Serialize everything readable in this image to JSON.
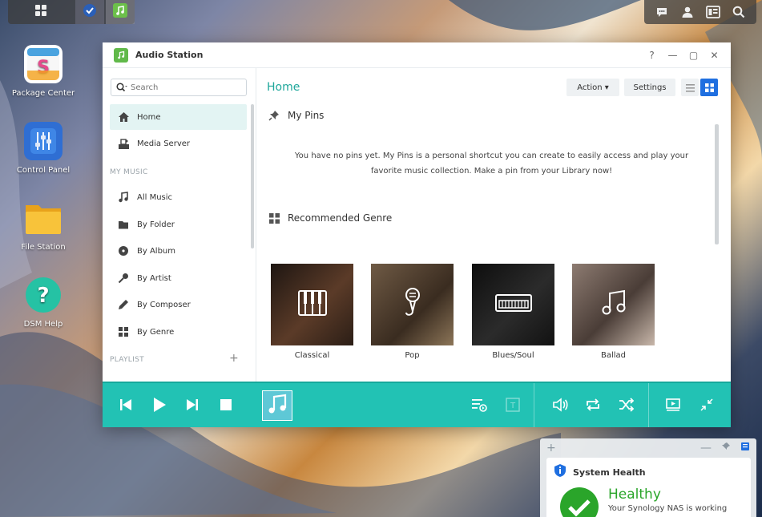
{
  "desktop": {
    "icons": [
      {
        "label": "Package Center",
        "icon": "package-center-icon"
      },
      {
        "label": "Control Panel",
        "icon": "control-panel-icon"
      },
      {
        "label": "File Station",
        "icon": "file-station-icon"
      },
      {
        "label": "DSM Help",
        "icon": "dsm-help-icon"
      }
    ]
  },
  "taskbar": {
    "left": [
      "main-menu-icon",
      "synology-sync-icon",
      "audio-station-icon"
    ],
    "right": [
      "chat-icon",
      "user-icon",
      "widgets-icon",
      "search-icon"
    ]
  },
  "window": {
    "title": "Audio Station",
    "controls": {
      "help": "?",
      "minimize": "—",
      "maximize": "▢",
      "close": "✕"
    }
  },
  "sidebar": {
    "search_placeholder": "Search",
    "items": [
      {
        "label": "Home",
        "icon": "home-icon",
        "active": true
      },
      {
        "label": "Media Server",
        "icon": "media-server-icon"
      }
    ],
    "my_music_heading": "MY MUSIC",
    "my_music": [
      {
        "label": "All Music",
        "icon": "music-note-icon"
      },
      {
        "label": "By Folder",
        "icon": "folder-icon"
      },
      {
        "label": "By Album",
        "icon": "album-icon"
      },
      {
        "label": "By Artist",
        "icon": "microphone-icon"
      },
      {
        "label": "By Composer",
        "icon": "pen-icon"
      },
      {
        "label": "By Genre",
        "icon": "grid-icon"
      }
    ],
    "playlist_heading": "PLAYLIST",
    "add_label": "+"
  },
  "main": {
    "title": "Home",
    "action_label": "Action ▾",
    "settings_label": "Settings",
    "pins_heading": "My Pins",
    "pins_message_line1": "You have no pins yet. My Pins is a personal shortcut you can create to easily access and play your",
    "pins_message_line2": "favorite music collection. Make a pin from your Library now!",
    "genre_heading": "Recommended Genre",
    "genres": [
      {
        "label": "Classical",
        "icon": "piano-icon",
        "color": "#3b2a22"
      },
      {
        "label": "Pop",
        "icon": "microphone-icon",
        "color": "#5a4635"
      },
      {
        "label": "Blues/Soul",
        "icon": "keyboard-icon",
        "color": "#1d1d1d"
      },
      {
        "label": "Ballad",
        "icon": "music-note-icon",
        "color": "#6b5a52"
      }
    ]
  },
  "player": {
    "accent": "#22c2b4",
    "buttons": [
      "previous-icon",
      "play-icon",
      "next-icon",
      "stop-icon",
      "queue-icon",
      "lyrics-icon",
      "volume-icon",
      "repeat-icon",
      "shuffle-icon",
      "cast-icon",
      "mini-player-icon"
    ]
  },
  "widget": {
    "add": "+",
    "title": "System Health",
    "status": "Healthy",
    "message": "Your Synology NAS is working",
    "status_color": "#2aa52a"
  }
}
